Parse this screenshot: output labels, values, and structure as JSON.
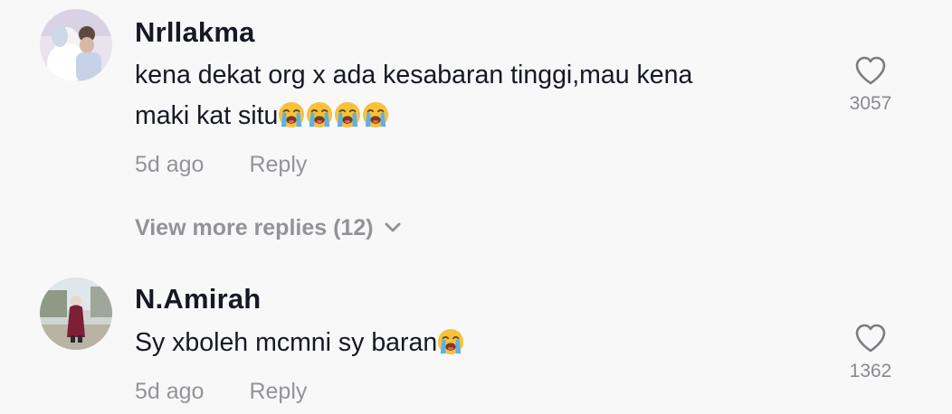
{
  "comments": [
    {
      "username": "Nrllakma",
      "text_line1": "kena dekat org x ada kesabaran tinggi,mau kena",
      "text_line2": "maki kat situ",
      "emoji_count": 4,
      "time": "5d ago",
      "reply_label": "Reply",
      "likes": "3057",
      "view_more": "View more replies (12)"
    },
    {
      "username": "N.Amirah",
      "text_line1": "Sy xboleh mcmni sy baran",
      "emoji_count": 1,
      "time": "5d ago",
      "reply_label": "Reply",
      "likes": "1362"
    }
  ],
  "icons": {
    "like": "heart-outline-icon",
    "emoji": "loudly-crying-face-emoji",
    "expand": "chevron-down-icon"
  },
  "colors": {
    "background": "#f8f8f8",
    "text": "#161823",
    "muted": "rgba(22,24,35,0.45)"
  }
}
